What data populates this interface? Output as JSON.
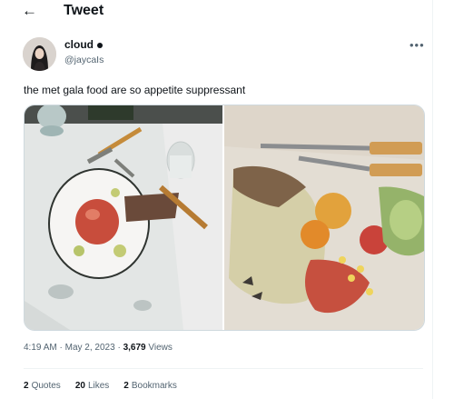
{
  "header": {
    "back_icon": "←",
    "title": "Tweet"
  },
  "author": {
    "name": "cloud",
    "handle": "@jaycaIs"
  },
  "more_icon": "•••",
  "tweet": {
    "text": "the met gala food are so appetite suppressant"
  },
  "media": {
    "image_count": 2
  },
  "meta": {
    "time": "4:19 AM",
    "sep1": "·",
    "date": "May 2, 2023",
    "sep2": "·",
    "views_count": "3,679",
    "views_label": "Views"
  },
  "stats": [
    {
      "count": "2",
      "label": "Quotes"
    },
    {
      "count": "20",
      "label": "Likes"
    },
    {
      "count": "2",
      "label": "Bookmarks"
    }
  ]
}
